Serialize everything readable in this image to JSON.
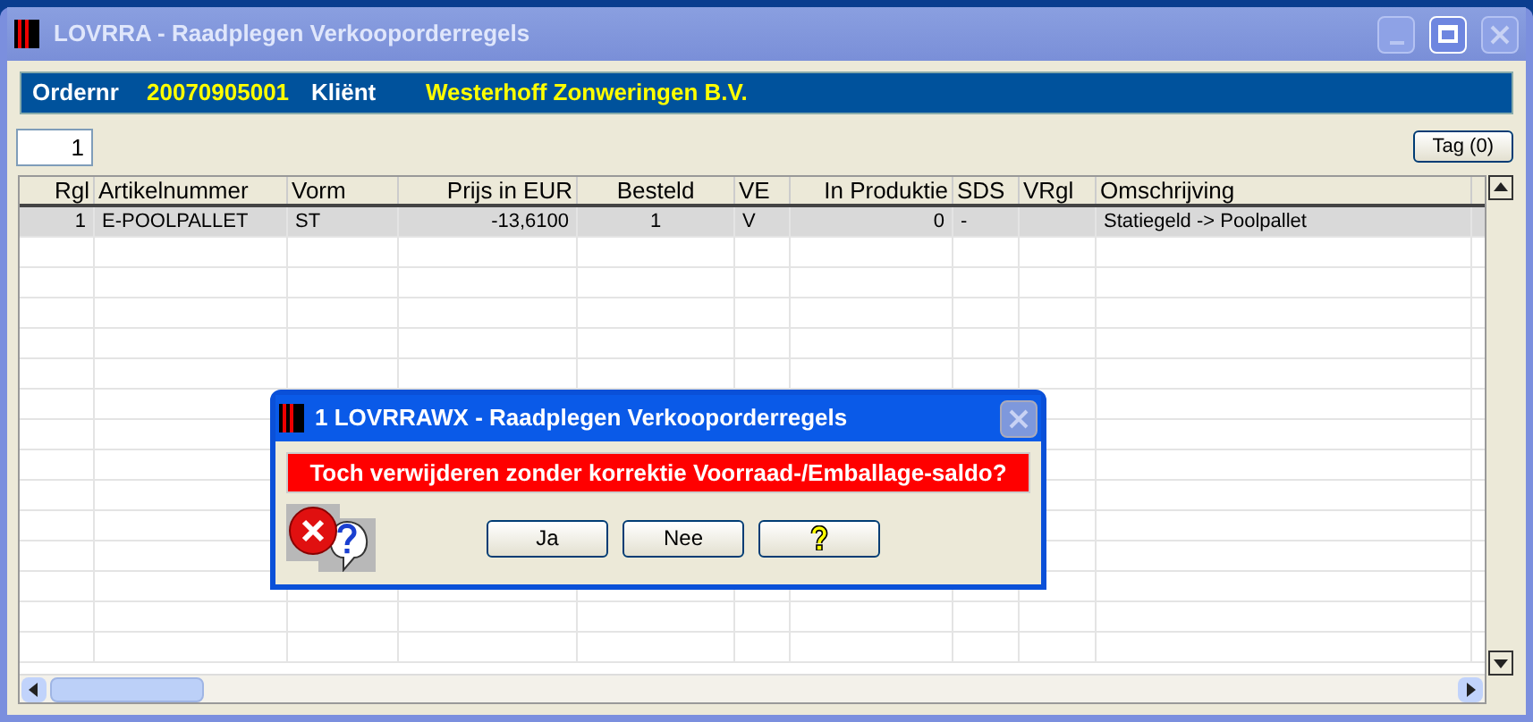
{
  "window": {
    "title": "LOVRRA - Raadplegen Verkooporderregels"
  },
  "header": {
    "order_label": "Ordernr",
    "order_value": "20070905001",
    "client_label": "Kliënt",
    "client_value": "Westerhoff Zonweringen B.V."
  },
  "toolbar": {
    "count_field": "1",
    "tag_button": "Tag (0)"
  },
  "table": {
    "columns": [
      {
        "label": "Rgl"
      },
      {
        "label": "Artikelnummer"
      },
      {
        "label": "Vorm"
      },
      {
        "label": "Prijs in EUR"
      },
      {
        "label": "Besteld"
      },
      {
        "label": "VE"
      },
      {
        "label": "In Produktie"
      },
      {
        "label": "SDS"
      },
      {
        "label": "VRgl"
      },
      {
        "label": "Omschrijving"
      }
    ],
    "rows": [
      {
        "selected": true,
        "cells": [
          "1",
          "E-POOLPALLET",
          "ST",
          "-13,6100",
          "1",
          "V",
          "0",
          "-",
          "",
          "Statiegeld -> Poolpallet"
        ]
      }
    ]
  },
  "dialog": {
    "title": "1 LOVRRAWX - Raadplegen Verkooporderregels",
    "message": "Toch verwijderen zonder korrektie Voorraad-/Emballage-saldo?",
    "buttons": [
      {
        "label": "Ja",
        "kind": "text"
      },
      {
        "label": "Nee",
        "kind": "text"
      },
      {
        "kind": "help"
      }
    ]
  }
}
